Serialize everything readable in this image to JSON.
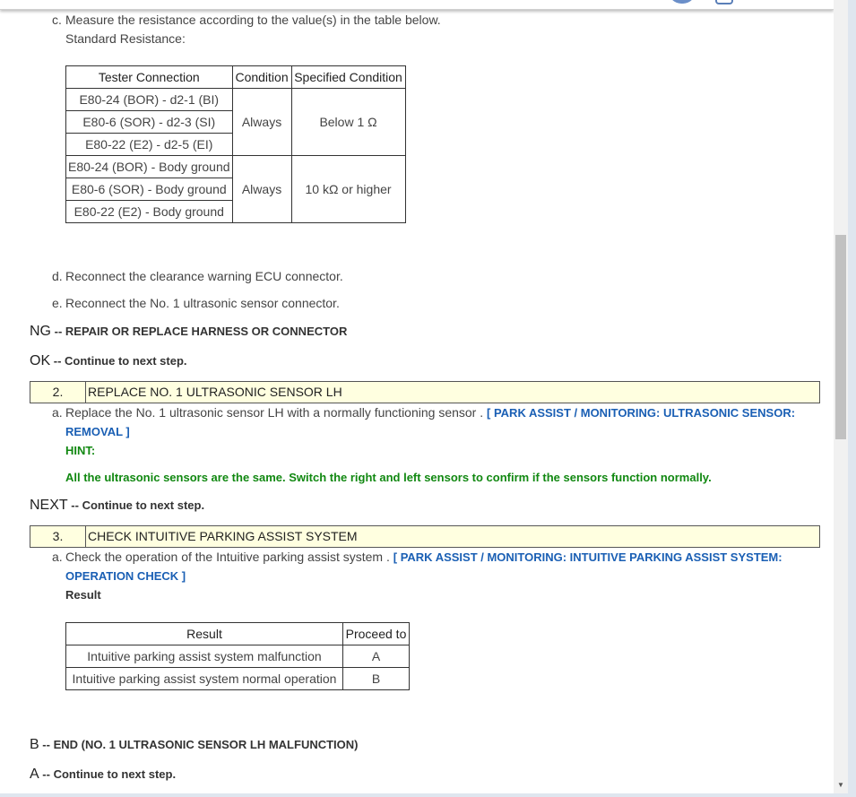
{
  "step_c": {
    "letter": "c.",
    "text": "Measure the resistance according to the value(s) in the table below.",
    "subtext": "Standard Resistance:"
  },
  "resistance_table": {
    "headers": [
      "Tester Connection",
      "Condition",
      "Specified Condition"
    ],
    "rows": [
      {
        "connection": "E80-24 (BOR) - d2-1 (BI)"
      },
      {
        "connection": "E80-6 (SOR) - d2-3 (SI)"
      },
      {
        "connection": "E80-22 (E2) - d2-5 (EI)"
      },
      {
        "connection": "E80-24 (BOR) - Body ground"
      },
      {
        "connection": "E80-6 (SOR) - Body ground"
      },
      {
        "connection": "E80-22 (E2) - Body ground"
      }
    ],
    "group1": {
      "condition": "Always",
      "specified": "Below 1 Ω"
    },
    "group2": {
      "condition": "Always",
      "specified": "10 kΩ or higher"
    }
  },
  "step_d": {
    "letter": "d.",
    "text": "Reconnect the clearance warning ECU connector."
  },
  "step_e": {
    "letter": "e.",
    "text": "Reconnect the No. 1 ultrasonic sensor connector."
  },
  "ng": {
    "key": "NG",
    "text": "-- REPAIR OR REPLACE HARNESS OR CONNECTOR"
  },
  "ok": {
    "key": "OK",
    "text": "-- Continue to next step."
  },
  "step2": {
    "number": "2.",
    "title": "REPLACE NO. 1 ULTRASONIC SENSOR LH",
    "a_letter": "a.",
    "a_text": "Replace the No. 1 ultrasonic sensor LH with a normally functioning sensor .",
    "a_link_1": "[ PARK ASSIST / MONITORING: ULTRASONIC SENSOR:",
    "a_link_2": "REMOVAL ]",
    "hint_label": "HINT:",
    "hint_text": "All the ultrasonic sensors are the same. Switch the right and left sensors to confirm if the sensors function normally."
  },
  "next": {
    "key": "NEXT",
    "text": "-- Continue to next step."
  },
  "step3": {
    "number": "3.",
    "title": "CHECK INTUITIVE PARKING ASSIST SYSTEM",
    "a_letter": "a.",
    "a_text": "Check the operation of the Intuitive parking assist system .",
    "a_link_1": "[ PARK ASSIST / MONITORING: INTUITIVE PARKING ASSIST SYSTEM:",
    "a_link_2": "OPERATION CHECK ]",
    "result_label": "Result"
  },
  "result_table": {
    "headers": [
      "Result",
      "Proceed to"
    ],
    "rows": [
      {
        "result": "Intuitive parking assist system malfunction",
        "proceed": "A"
      },
      {
        "result": "Intuitive parking assist system normal operation",
        "proceed": "B"
      }
    ]
  },
  "b_line": {
    "key": "B",
    "text": "-- END (NO. 1 ULTRASONIC SENSOR LH MALFUNCTION)"
  },
  "a_line": {
    "key": "A",
    "text": "-- Continue to next step."
  }
}
